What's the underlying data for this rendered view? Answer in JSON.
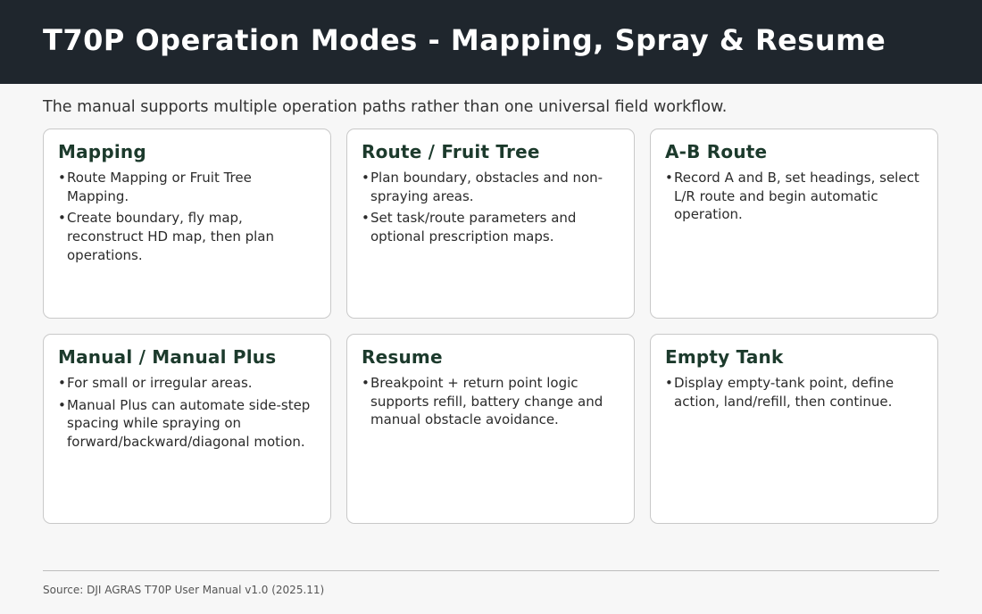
{
  "header": {
    "title": "T70P Operation Modes - Mapping, Spray & Resume"
  },
  "intro": "The manual supports multiple operation paths rather than one universal field workflow.",
  "bullet_glyph": "•",
  "cards": [
    {
      "title": "Mapping",
      "bullets": [
        "Route Mapping or Fruit Tree Mapping.",
        "Create boundary, fly map, reconstruct HD map, then plan operations."
      ]
    },
    {
      "title": "Route / Fruit Tree",
      "bullets": [
        "Plan boundary, obstacles and non-spraying areas.",
        "Set task/route parameters and optional prescription maps."
      ]
    },
    {
      "title": "A-B Route",
      "bullets": [
        "Record A and B, set headings, select L/R route and begin automatic operation."
      ]
    },
    {
      "title": "Manual / Manual Plus",
      "bullets": [
        "For small or irregular areas.",
        "Manual Plus can automate side-step spacing while spraying on forward/backward/diagonal motion."
      ]
    },
    {
      "title": "Resume",
      "bullets": [
        "Breakpoint + return point logic supports refill, battery change and manual obstacle avoidance."
      ]
    },
    {
      "title": "Empty Tank",
      "bullets": [
        "Display empty-tank point, define action, land/refill, then continue."
      ]
    }
  ],
  "footer": {
    "source": "Source: DJI AGRAS T70P User Manual v1.0 (2025.11)"
  }
}
